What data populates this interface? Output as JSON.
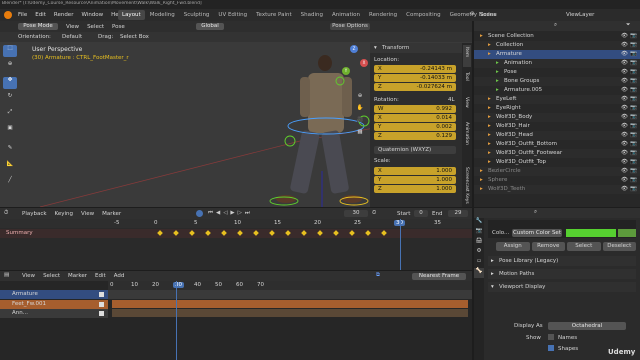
{
  "window_title": "Blender* [I:\\Udemy_Course_Resource\\Animation\\Movement\\Walk\\Walk_Right_Fwd.blend]",
  "menu": [
    "File",
    "Edit",
    "Render",
    "Window",
    "Help"
  ],
  "workspace_tabs": [
    "Layout",
    "Modeling",
    "Sculpting",
    "UV Editing",
    "Texture Paint",
    "Shading",
    "Animation",
    "Rendering",
    "Compositing",
    "Geometry Nodes"
  ],
  "active_tab": "Layout",
  "scene_label": "Scene",
  "view_layer_label": "ViewLayer",
  "viewport": {
    "mode": "Pose Mode",
    "header_menus": [
      "View",
      "Select",
      "Pose"
    ],
    "transform_orientation": "Global",
    "orientation_label": "Orientation:",
    "orientation_value": "Default",
    "drag_label": "Drag:",
    "drag_value": "Select Box",
    "overlay_title": "User Perspective",
    "overlay_sub": "(30) Armature : CTRL_FootMaster_r"
  },
  "n_panel": {
    "tabs": [
      "Item",
      "Tool",
      "View",
      "Animation",
      "Screencast Keys"
    ],
    "transform_header": "Transform",
    "location_label": "Location:",
    "location": [
      {
        "axis": "X",
        "value": "-0.24143 m"
      },
      {
        "axis": "Y",
        "value": "-0.14033 m"
      },
      {
        "axis": "Z",
        "value": "-0.027624 m"
      }
    ],
    "rotation_label": "Rotation:",
    "rotation_mode_tag": "4L",
    "rotation": [
      {
        "axis": "W",
        "value": "0.992"
      },
      {
        "axis": "X",
        "value": "0.014"
      },
      {
        "axis": "Y",
        "value": "0.002"
      },
      {
        "axis": "Z",
        "value": "0.129"
      }
    ],
    "rotation_mode": "Quaternion (WXYZ)",
    "scale_label": "Scale:",
    "scale": [
      {
        "axis": "X",
        "value": "1.000"
      },
      {
        "axis": "Y",
        "value": "1.000"
      },
      {
        "axis": "Z",
        "value": "1.000"
      }
    ]
  },
  "outliner": {
    "items": [
      {
        "label": "Scene Collection",
        "indent": 0
      },
      {
        "label": "Collection",
        "indent": 1
      },
      {
        "label": "Armature",
        "indent": 1
      },
      {
        "label": "Animation",
        "indent": 2
      },
      {
        "label": "Pose",
        "indent": 2
      },
      {
        "label": "Bone Groups",
        "indent": 2
      },
      {
        "label": "Armature.005",
        "indent": 2
      },
      {
        "label": "EyeLeft",
        "indent": 1
      },
      {
        "label": "EyeRight",
        "indent": 1
      },
      {
        "label": "Wolf3D_Body",
        "indent": 1
      },
      {
        "label": "Wolf3D_Hair",
        "indent": 1
      },
      {
        "label": "Wolf3D_Head",
        "indent": 1
      },
      {
        "label": "Wolf3D_Outfit_Bottom",
        "indent": 1
      },
      {
        "label": "Wolf3D_Outfit_Footwear",
        "indent": 1
      },
      {
        "label": "Wolf3D_Outfit_Top",
        "indent": 1
      },
      {
        "label": "BezierCircle",
        "indent": 0
      },
      {
        "label": "Sphere",
        "indent": 0
      },
      {
        "label": "Wolf3D_Teeth",
        "indent": 0
      }
    ]
  },
  "timeline": {
    "menus": [
      "Playback",
      "Keying",
      "View",
      "Marker"
    ],
    "current_frame": "30",
    "start_label": "Start",
    "start": "0",
    "end_label": "End",
    "end": "29",
    "ruler": [
      "-5",
      "0",
      "5",
      "10",
      "15",
      "20",
      "25",
      "30",
      "35"
    ],
    "summary_label": "Summary"
  },
  "nla": {
    "menus": [
      "View",
      "Select",
      "Marker",
      "Edit",
      "Add"
    ],
    "snap": "Nearest Frame",
    "ruler": [
      "0",
      "10",
      "20",
      "30",
      "40",
      "50",
      "60",
      "70"
    ],
    "current_frame": "30",
    "tracks": [
      "Armature",
      "Feet_Fw.001",
      "Ann..."
    ]
  },
  "properties": {
    "color_set_label": "Colo...",
    "color_set_value": "Custom Color Set",
    "buttons": [
      "Assign",
      "Remove",
      "Select",
      "Deselect"
    ],
    "sections": [
      "Pose Library (Legacy)",
      "Motion Paths",
      "Viewport Display"
    ],
    "display_as_label": "Display As",
    "display_as_value": "Octahedral",
    "show_label": "Show",
    "names_label": "Names",
    "shapes_label": "Shapes",
    "watermark": "Udemy"
  },
  "colors": {
    "accent_blue": "#4772b3",
    "key_yellow": "#e8c020",
    "field_yellow": "#c8a22a",
    "green_swatch": "#56d030"
  }
}
